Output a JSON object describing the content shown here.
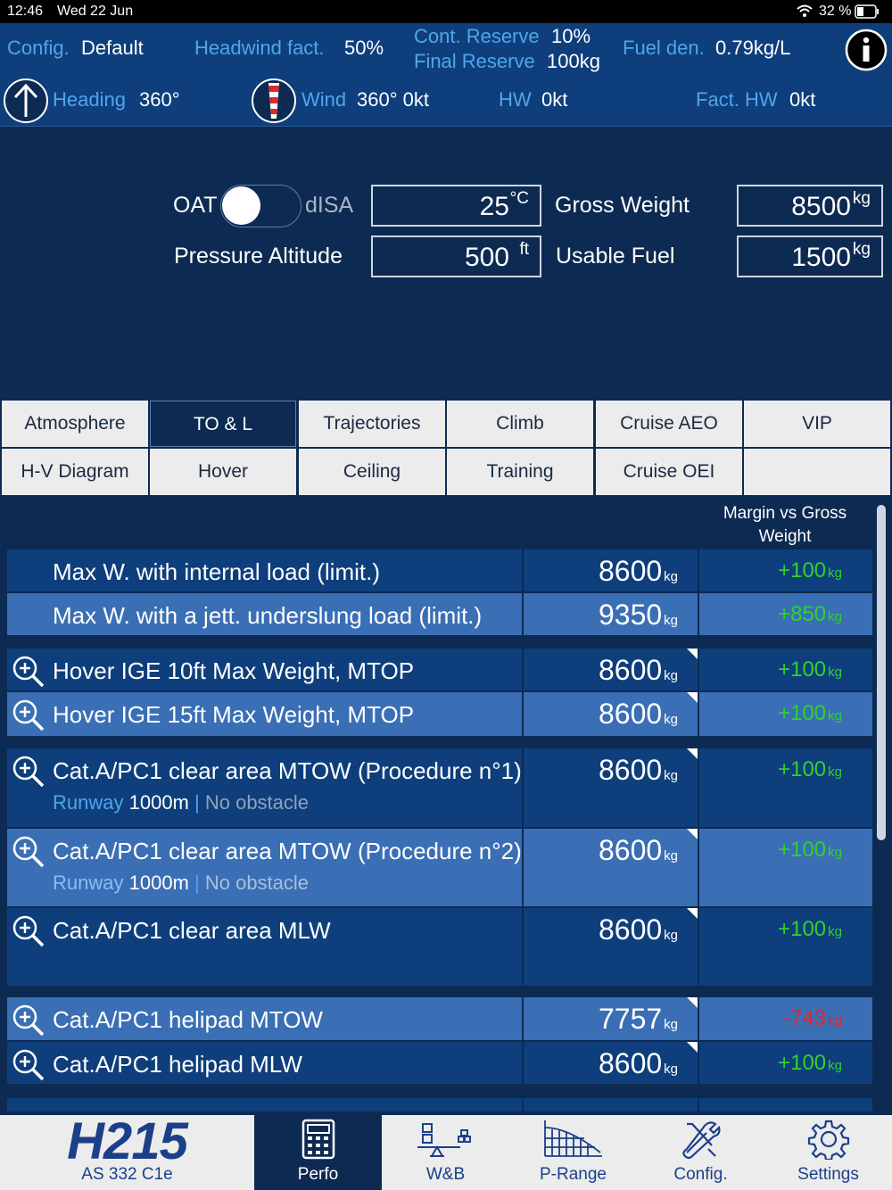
{
  "status": {
    "time": "12:46",
    "date": "Wed 22 Jun",
    "battery": "32 %"
  },
  "header": {
    "config_label": "Config.",
    "config_value": "Default",
    "headwind_label": "Headwind fact.",
    "headwind_value": "50%",
    "cont_reserve_label": "Cont. Reserve",
    "cont_reserve_value": "10%",
    "final_reserve_label": "Final Reserve",
    "final_reserve_value": "100kg",
    "fuel_den_label": "Fuel den.",
    "fuel_den_value": "0.79kg/L",
    "heading_label": "Heading",
    "heading_value": "360°",
    "wind_label": "Wind",
    "wind_value": "360° 0kt",
    "hw_label": "HW",
    "hw_value": "0kt",
    "fact_hw_label": "Fact. HW",
    "fact_hw_value": "0kt"
  },
  "form": {
    "oat_label": "OAT",
    "disa_label": "dISA",
    "oat_value": "25",
    "oat_unit": "°C",
    "pa_label": "Pressure Altitude",
    "pa_value": "500",
    "pa_unit": "ft",
    "gw_label": "Gross Weight",
    "gw_value": "8500",
    "gw_unit": "kg",
    "uf_label": "Usable Fuel",
    "uf_value": "1500",
    "uf_unit": "kg"
  },
  "tabs": [
    "Atmosphere",
    "TO & L",
    "Trajectories",
    "Climb",
    "Cruise AEO",
    "VIP",
    "H-V Diagram",
    "Hover",
    "Ceiling",
    "Training",
    "Cruise OEI",
    ""
  ],
  "active_tab": "TO & L",
  "list": {
    "margin_header": "Margin vs Gross Weight",
    "rows": [
      {
        "label": "Max W. with internal load (limit.)",
        "value": "8600",
        "unit": "kg",
        "margin": "+100",
        "mcolor": "#2fd12f"
      },
      {
        "label": "Max W. with a jett. underslung load (limit.)",
        "value": "9350",
        "unit": "kg",
        "margin": "+850",
        "mcolor": "#2fd12f"
      },
      {
        "label": "Hover IGE 10ft Max Weight, MTOP",
        "value": "8600",
        "unit": "kg",
        "margin": "+100",
        "mcolor": "#2fd12f"
      },
      {
        "label": "Hover IGE 15ft Max Weight, MTOP",
        "value": "8600",
        "unit": "kg",
        "margin": "+100",
        "mcolor": "#2fd12f"
      },
      {
        "label": "Cat.A/PC1 clear area MTOW (Procedure n°1)",
        "value": "8600",
        "unit": "kg",
        "margin": "+100",
        "mcolor": "#2fd12f",
        "sub_a": "Runway",
        "sub_b": "1000m",
        "sub_sep": " | ",
        "sub_c": "No obstacle"
      },
      {
        "label": "Cat.A/PC1 clear area MTOW (Procedure n°2)",
        "value": "8600",
        "unit": "kg",
        "margin": "+100",
        "mcolor": "#2fd12f",
        "sub_a": "Runway",
        "sub_b": "1000m",
        "sub_sep": " | ",
        "sub_c": "No obstacle"
      },
      {
        "label": "Cat.A/PC1 clear area MLW",
        "value": "8600",
        "unit": "kg",
        "margin": "+100",
        "mcolor": "#2fd12f"
      },
      {
        "label": "Cat.A/PC1 helipad MTOW",
        "value": "7757",
        "unit": "kg",
        "margin": "-743",
        "mcolor": "#e0282c"
      },
      {
        "label": "Cat.A/PC1 helipad MLW",
        "value": "8600",
        "unit": "kg",
        "margin": "+100",
        "mcolor": "#2fd12f"
      }
    ]
  },
  "bottom": {
    "logo": "H215",
    "model": "AS 332 C1e",
    "perfo": "Perfo",
    "wb": "W&B",
    "prange": "P-Range",
    "config": "Config.",
    "settings": "Settings"
  }
}
